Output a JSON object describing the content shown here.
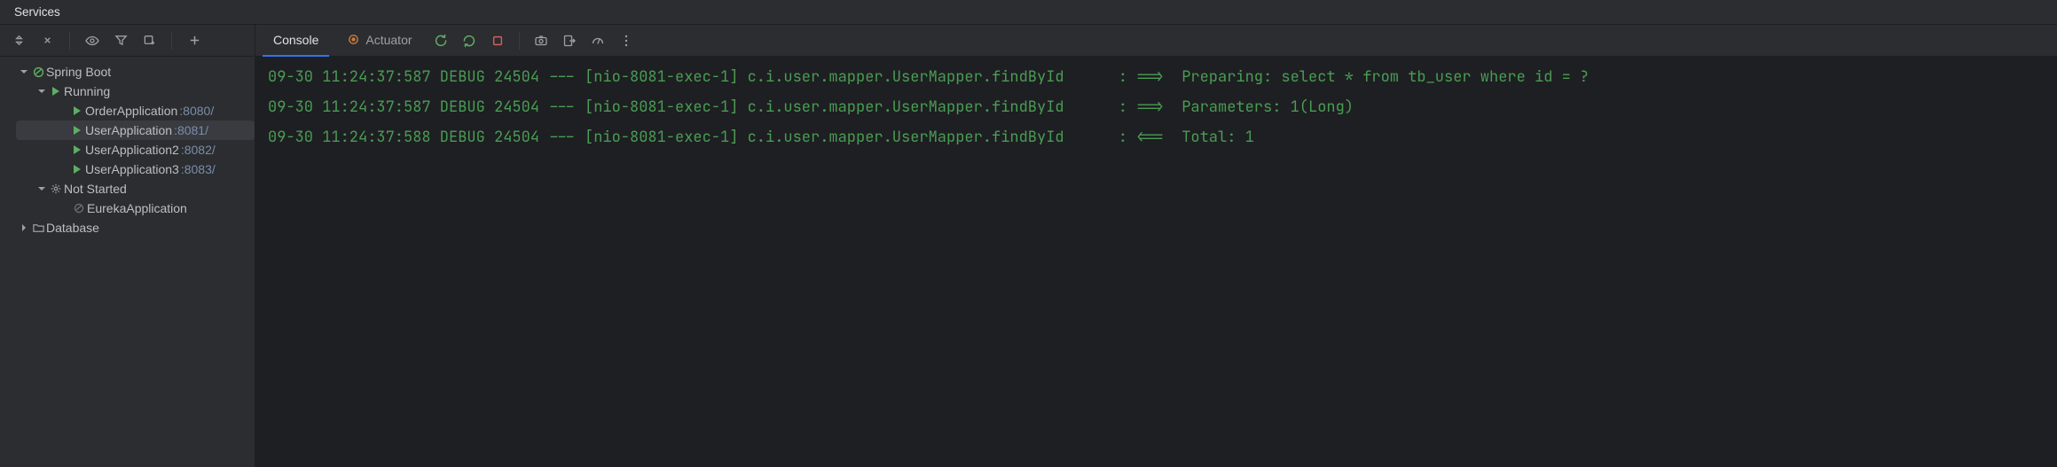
{
  "titlebar": {
    "title": "Services"
  },
  "tree": {
    "springRoot": "Spring Boot",
    "running": "Running",
    "apps": [
      {
        "name": "OrderApplication",
        "port": ":8080/",
        "selected": false
      },
      {
        "name": "UserApplication",
        "port": ":8081/",
        "selected": true
      },
      {
        "name": "UserApplication2",
        "port": ":8082/",
        "selected": false
      },
      {
        "name": "UserApplication3",
        "port": ":8083/",
        "selected": false
      }
    ],
    "notStarted": "Not Started",
    "notStartedApps": [
      {
        "name": "EurekaApplication"
      }
    ],
    "database": "Database"
  },
  "rightTabs": {
    "console": "Console",
    "actuator": "Actuator"
  },
  "console": {
    "lines": [
      "09-30 11:24:37:587 DEBUG 24504 --- [nio-8081-exec-1] c.i.user.mapper.UserMapper.findById      : ==>  Preparing: select * from tb_user where id = ?",
      "09-30 11:24:37:587 DEBUG 24504 --- [nio-8081-exec-1] c.i.user.mapper.UserMapper.findById      : ==>  Parameters: 1(Long)",
      "09-30 11:24:37:588 DEBUG 24504 --- [nio-8081-exec-1] c.i.user.mapper.UserMapper.findById      : <==  Total: 1"
    ]
  }
}
